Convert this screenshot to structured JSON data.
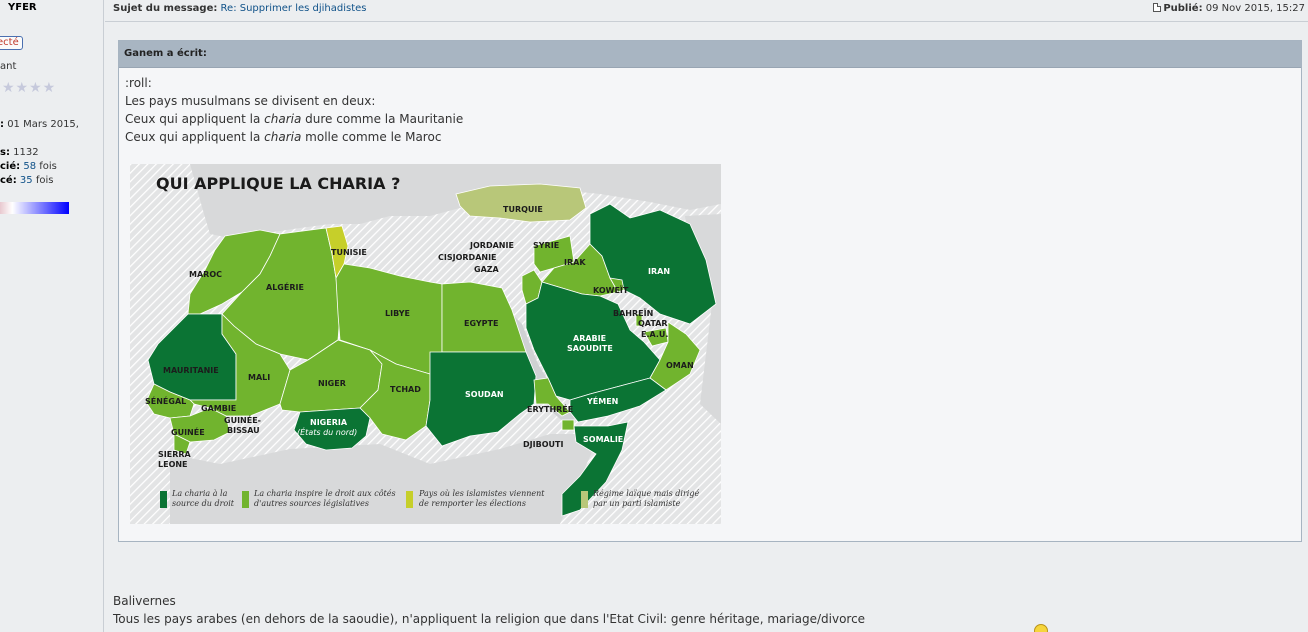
{
  "profile": {
    "name": "YFER",
    "badge": "ecté",
    "rank": "ant",
    "stars": "★★★★",
    "joined_label": ":",
    "joined_value": "01 Mars 2015,",
    "posts_label": "s:",
    "posts_value": "1132",
    "thanked_label": "cié:",
    "thanked_value": "58",
    "thanked_suffix": "fois",
    "been_thanked_label": "cé:",
    "been_thanked_value": "35",
    "been_thanked_suffix": "fois"
  },
  "post": {
    "subject_label": "Sujet du message:",
    "subject_link": "Re: Supprimer les djihadistes",
    "published_label": "Publié:",
    "published_value": "09 Nov 2015, 15:27",
    "quote_author": "Ganem a écrit:",
    "quote_line1": ":roll:",
    "quote_line2": "Les pays musulmans se divisent en deux:",
    "quote_line3_a": "Ceux qui appliquent la ",
    "quote_line3_i": "charia",
    "quote_line3_b": " dure comme la Mauritanie",
    "quote_line4_a": "Ceux qui appliquent la ",
    "quote_line4_i": "charia",
    "quote_line4_b": " molle comme le Maroc",
    "reply_line1": "Balivernes",
    "reply_line2": "Tous les pays arabes (en dehors de la saoudie), n'appliquent la religion que dans l'Etat Civil: genre héritage, mariage/divorce"
  },
  "map": {
    "title": "QUI APPLIQUE LA CHARIA ?",
    "colors": {
      "dark": "#0b7434",
      "medium": "#71b42e",
      "yellow": "#c6cf2a",
      "turkey": "#b8c779",
      "other": "#d8d9da",
      "sea": "#cfd1d3"
    },
    "labels": {
      "turquie": "TURQUIE",
      "tunisie": "TUNISIE",
      "maroc": "MAROC",
      "algerie": "ALGÉRIE",
      "libye": "LIBYE",
      "egypte": "EGYPTE",
      "jordanie": "JORDANIE",
      "syrie": "SYRIE",
      "cisjordanie": "CISJORDANIE",
      "gaza": "GAZA",
      "irak": "IRAK",
      "iran": "IRAN",
      "koweit": "KOWEÏT",
      "bahrein": "BAHREÏN",
      "qatar": "QATAR",
      "eau": "E.A.U.",
      "arabie1": "ARABIE",
      "arabie2": "SAOUDITE",
      "oman": "OMAN",
      "mauritanie": "MAURITANIE",
      "mali": "MALI",
      "niger": "NIGER",
      "tchad": "TCHAD",
      "soudan": "SOUDAN",
      "yemen": "YÉMEN",
      "erythree": "ERYTHRÉE",
      "djibouti": "DJIBOUTI",
      "somalie": "SOMALIE",
      "senegal": "SÉNÉGAL",
      "gambie": "GAMBIE",
      "guinee_bissau1": "GUINÉE-",
      "guinee_bissau2": "BISSAU",
      "guinee": "GUINÉE",
      "sierra1": "SIERRA",
      "sierra2": "LEONE",
      "nigeria1": "NIGERIA",
      "nigeria2": "(États du nord)"
    },
    "legend": {
      "l1a": "La charia à la",
      "l1b": "source du droit",
      "l2a": "La charia inspire le droit aux côtés",
      "l2b": "d'autres sources législatives",
      "l3a": "Pays où les islamistes viennent",
      "l3b": "de remporter les élections",
      "l4a": "Régime laïque mais dirigé",
      "l4b": "par un parti islamiste"
    }
  }
}
